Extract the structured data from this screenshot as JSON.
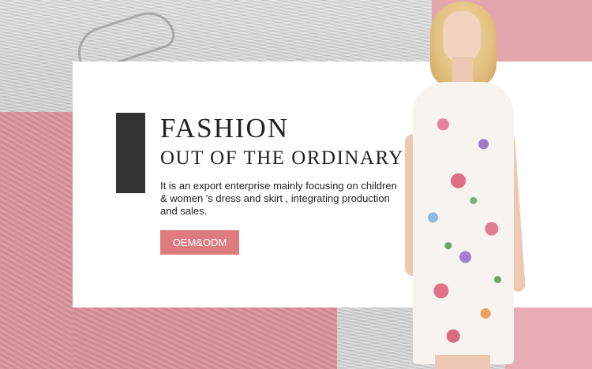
{
  "headline": "FASHION",
  "subheadline": "OUT OF THE ORDINARY",
  "description": "It is an export enterprise mainly focusing on children & women 's dress and skirt , integrating production and sales.",
  "cta_label": "OEM&ODM",
  "colors": {
    "accent_bar": "#333333",
    "cta_background": "#de7b7e",
    "pink_panel": "#d88f98",
    "card_background": "#ffffff"
  }
}
